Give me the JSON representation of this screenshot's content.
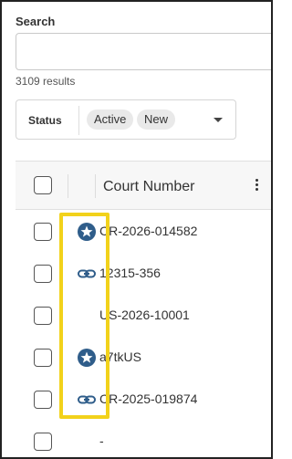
{
  "search": {
    "label": "Search",
    "value": "",
    "placeholder": "",
    "results": "3109 results"
  },
  "filter": {
    "label": "Status",
    "chips": [
      "Active",
      "New"
    ]
  },
  "grid": {
    "column_title": "Court Number",
    "rows": [
      {
        "icon": "star-badge-icon",
        "court_number": "CR-2026-014582"
      },
      {
        "icon": "link-icon",
        "court_number": "12315-356"
      },
      {
        "icon": "",
        "court_number": "US-2026-10001"
      },
      {
        "icon": "star-badge-icon",
        "court_number": "a7tkUS"
      },
      {
        "icon": "link-icon",
        "court_number": "CR-2025-019874"
      },
      {
        "icon": "",
        "court_number": "-"
      }
    ]
  },
  "colors": {
    "icon": "#2f5d8a",
    "highlight": "#f2d21b"
  }
}
